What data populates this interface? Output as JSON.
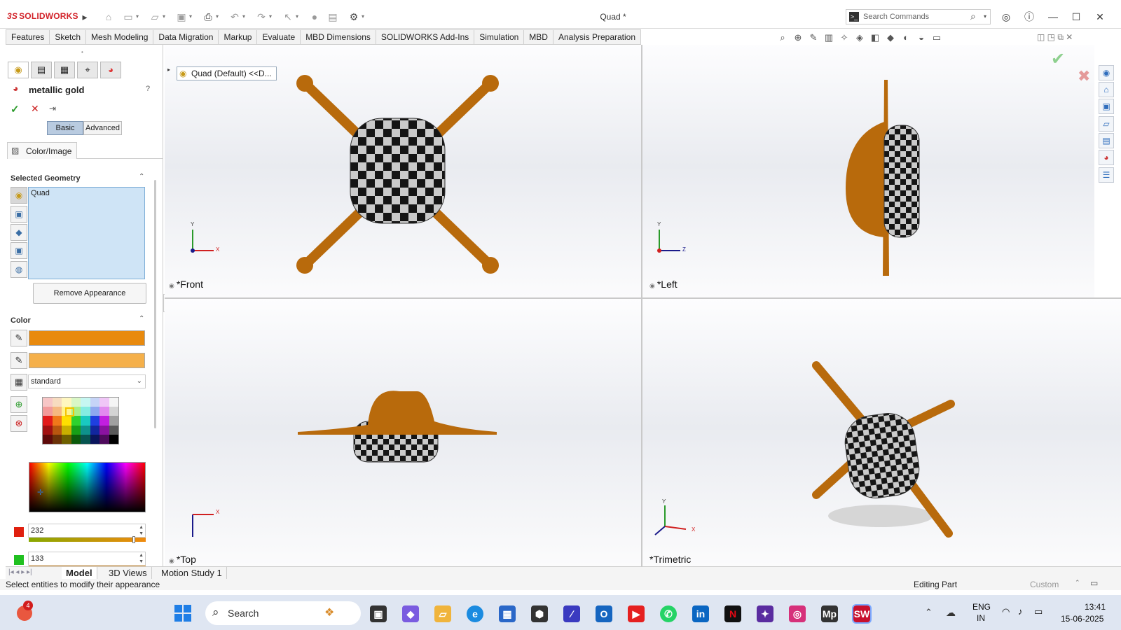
{
  "title_bar": {
    "app_name": "SOLIDWORKS",
    "document_title": "Quad *",
    "search_placeholder": "Search Commands"
  },
  "command_tabs": [
    "Features",
    "Sketch",
    "Mesh Modeling",
    "Data Migration",
    "Markup",
    "Evaluate",
    "MBD Dimensions",
    "SOLIDWORKS Add-Ins",
    "Simulation",
    "MBD",
    "Analysis Preparation"
  ],
  "property_manager": {
    "title": "metallic gold",
    "mode_tabs": {
      "basic": "Basic",
      "advanced": "Advanced"
    },
    "color_image_tab": "Color/Image",
    "selected_geometry": {
      "heading": "Selected Geometry",
      "items": [
        "Quad"
      ]
    },
    "remove_button": "Remove Appearance",
    "color": {
      "heading": "Color",
      "primary_hex": "#E88A0E",
      "secondary_hex": "#F5B04A",
      "palette_select": "standard",
      "red_value": "232",
      "green_value": "133"
    }
  },
  "feature_tree_item": "Quad (Default) <<D...",
  "viewports": {
    "front": "*Front",
    "left": "*Left",
    "top": "*Top",
    "trimetric": "*Trimetric"
  },
  "axes": {
    "x": "X",
    "y": "Y",
    "z": "Z"
  },
  "bottom_tabs": [
    "Model",
    "3D Views",
    "Motion Study 1"
  ],
  "status_bar": {
    "message": "Select entities to modify their appearance",
    "mode": "Editing Part",
    "units": "Custom"
  },
  "taskbar": {
    "search": "Search",
    "notification_count": "4",
    "language": "ENG",
    "region": "IN",
    "time": "13:41",
    "date": "15-06-2025"
  },
  "colors": {
    "model_orange": "#B86A0C",
    "accent_blue": "#2F6EBD",
    "checker_dark": "#1a1a1a",
    "checker_light": "#c8c8c8"
  }
}
